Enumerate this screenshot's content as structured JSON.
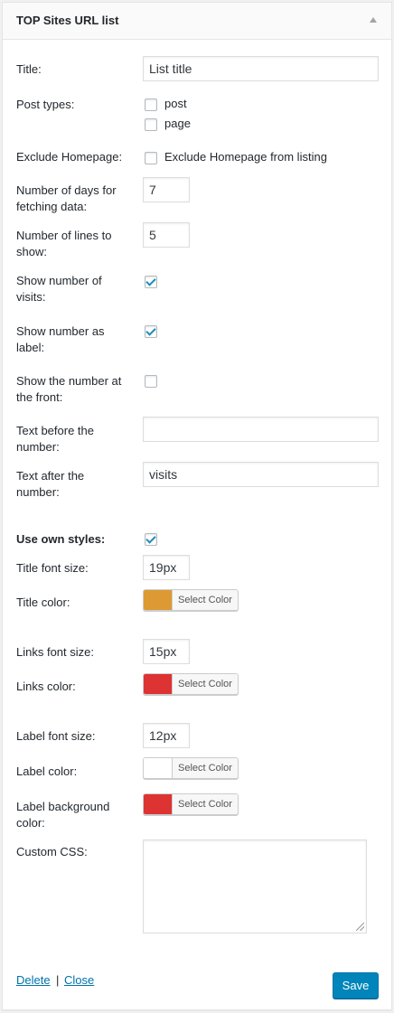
{
  "widget": {
    "title": "TOP Sites URL list"
  },
  "fields": {
    "title": {
      "label": "Title:",
      "value": "List title"
    },
    "post_types": {
      "label": "Post types:",
      "options": [
        "post",
        "page"
      ],
      "checked": [
        false,
        false
      ]
    },
    "exclude_homepage": {
      "label": "Exclude Homepage:",
      "option": "Exclude Homepage from listing",
      "checked": false
    },
    "days": {
      "label_l1": "Number of days for",
      "label_l2": "fetching data:",
      "value": "7"
    },
    "lines": {
      "label_l1": "Number of lines to",
      "label_l2": "show:",
      "value": "5"
    },
    "show_visits": {
      "label_l1": "Show number of",
      "label_l2": "visits:",
      "checked": true
    },
    "show_as_label": {
      "label_l1": "Show number as",
      "label_l2": "label:",
      "checked": true
    },
    "number_front": {
      "label_l1": "Show the number at",
      "label_l2": "the front:",
      "checked": false
    },
    "text_before": {
      "label_l1": "Text before the",
      "label_l2": "number:",
      "value": ""
    },
    "text_after": {
      "label_l1": "Text after the",
      "label_l2": "number:",
      "value": "visits"
    },
    "own_styles": {
      "label": "Use own styles:",
      "checked": true
    },
    "title_font_size": {
      "label": "Title font size:",
      "value": "19px"
    },
    "title_color": {
      "label": "Title color:",
      "button": "Select Color",
      "color": "#dd9933"
    },
    "links_font_size": {
      "label": "Links font size:",
      "value": "15px"
    },
    "links_color": {
      "label": "Links color:",
      "button": "Select Color",
      "color": "#dd3333"
    },
    "label_font_size": {
      "label": "Label font size:",
      "value": "12px"
    },
    "label_color": {
      "label": "Label color:",
      "button": "Select Color",
      "color": "#ffffff"
    },
    "label_bg_color": {
      "label_l1": "Label background",
      "label_l2": "color:",
      "button": "Select Color",
      "color": "#dd3333"
    },
    "custom_css": {
      "label": "Custom CSS:",
      "value": ""
    }
  },
  "actions": {
    "delete": "Delete",
    "separator": "|",
    "close": "Close",
    "save": "Save"
  },
  "icons": {
    "toggle": "triangle-up-icon",
    "checkbox_checked": "checkmark-icon",
    "resize": "resize-grip-icon"
  },
  "colors": {
    "accent": "#0085ba",
    "link": "#0073aa",
    "checkmark": "#1e8cbe"
  }
}
